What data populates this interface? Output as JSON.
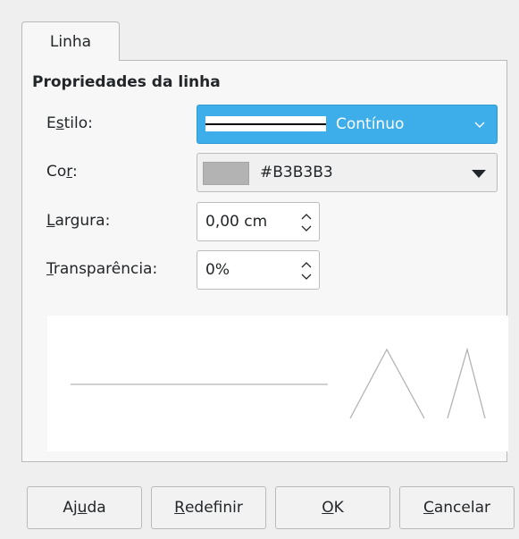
{
  "tab": {
    "label": "Linha"
  },
  "section": {
    "title": "Propriedades da linha"
  },
  "style": {
    "label_pre": "E",
    "label_mnemonic": "s",
    "label_post": "tilo:",
    "value": "Contínuo"
  },
  "color": {
    "label_pre": "Co",
    "label_mnemonic": "r",
    "label_post": ":",
    "value": "#B3B3B3",
    "swatch_color": "#b3b3b3"
  },
  "width": {
    "label_pre": "",
    "label_mnemonic": "L",
    "label_post": "argura:",
    "value": "0,00 cm"
  },
  "transparency": {
    "label_pre": "",
    "label_mnemonic": "T",
    "label_post": "ransparência:",
    "value": "0%"
  },
  "buttons": {
    "help": {
      "pre": "Aj",
      "mnemonic": "u",
      "post": "da"
    },
    "reset": {
      "pre": "",
      "mnemonic": "R",
      "post": "edefinir"
    },
    "ok": {
      "pre": "",
      "mnemonic": "O",
      "post": "K"
    },
    "cancel": {
      "pre": "",
      "mnemonic": "C",
      "post": "ancelar"
    }
  },
  "colors": {
    "highlight": "#3daee9",
    "background": "#efefef",
    "preview_line": "#b3b3b3"
  },
  "icons": [
    "chevron-down-icon",
    "dropdown-triangle-icon",
    "spin-arrows-icon"
  ]
}
